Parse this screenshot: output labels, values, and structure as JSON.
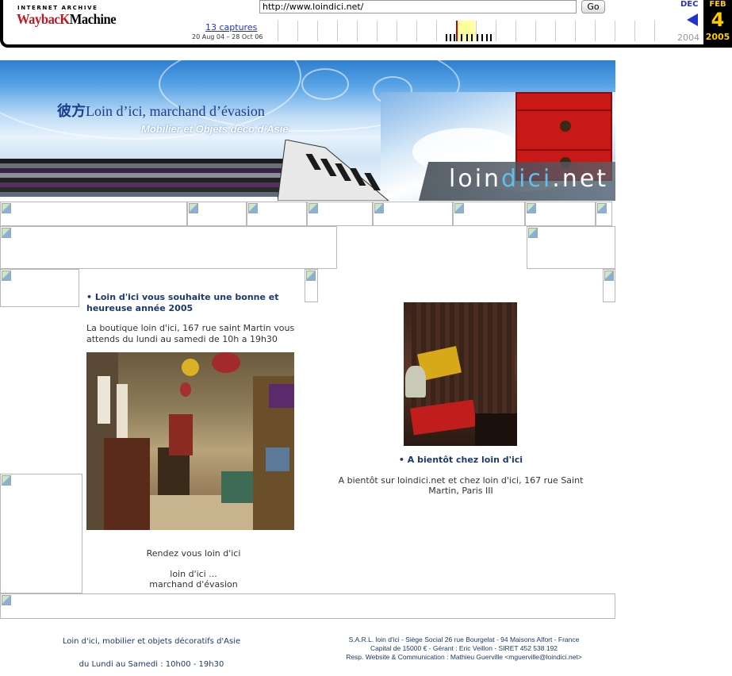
{
  "wayback": {
    "logo_top": "INTERNET ARCHIVE",
    "logo_way": "WaybacK",
    "logo_machine": "Machine",
    "url": "http://www.loindici.net/",
    "go_label": "Go",
    "captures_label": "13 captures",
    "date_range": "20 Aug 04 – 28 Oct 06",
    "prev_month": "DEC",
    "current_month": "FEB",
    "current_day": "4",
    "prev_year": "2004",
    "current_year": "2005",
    "accent_color": "#2233cc",
    "highlight_color": "#ffcc00"
  },
  "banner": {
    "title_cn": "彼方",
    "title": "Loin d’ici, marchand d’évasion",
    "subtitle": "Mobilier et Objets déco d’Asie",
    "brand_a": "loin",
    "brand_b": "dici",
    "brand_c": ".net"
  },
  "news": {
    "heading": "• Loin d'ici vous souhaite une bonne et heureuse année 2005",
    "intro": "La boutique loin d'ici, 167 rue saint Martin vous attends du lundi au samedi de 10h a 19h30",
    "caption_1": "Rendez vous loin d'ici",
    "caption_2": "loin d'ici ...",
    "caption_3": "marchand d'évasion"
  },
  "soon": {
    "heading": "• A bientôt chez loin d'ici",
    "text": "A bientôt sur loindici.net et chez loin d'ici, 167 rue Saint Martin, Paris III"
  },
  "footer": {
    "left_line1": "Loin d'ici, mobilier et objets décoratifs d'Asie",
    "left_line2": "du Lundi au Samedi : 10h00 - 19h30",
    "right_line1": "S.A.R.L. loin d'ici - Siège Social 26 rue Bourgelat - 94 Maisons Alfort - France",
    "right_line2": "Capital de 15000 € - Gérant : Eric Veillon - SIRET 452 538 192",
    "right_line3": "Resp. Website & Communication : Mathieu Guerville <mguerville@loindici.net>"
  }
}
